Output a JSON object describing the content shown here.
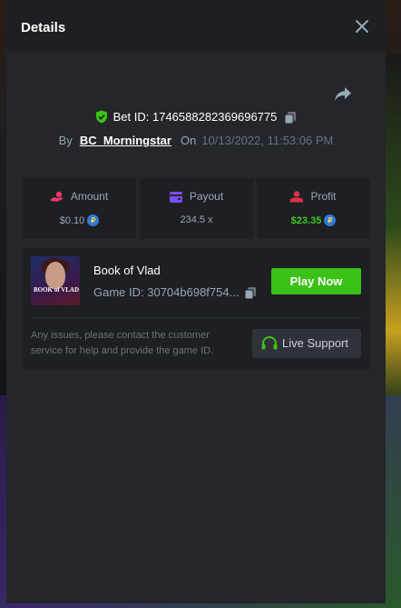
{
  "modal": {
    "title": "Details"
  },
  "bet": {
    "id_text": "Bet ID: 1746588282369696775",
    "by_label": "By",
    "user": "BC_Morningstar",
    "on_label": "On",
    "date": "10/13/2022, 11:53:06 PM"
  },
  "stats": {
    "amount": {
      "label": "Amount",
      "value": "$0.10"
    },
    "payout": {
      "label": "Payout",
      "value": "234.5 x"
    },
    "profit": {
      "label": "Profit",
      "value": "$23.35"
    }
  },
  "game": {
    "name": "Book of Vlad",
    "id_text": "Game ID: 30704b698f754...",
    "thumb_title": "BOOK of VLAD",
    "play_label": "Play Now",
    "note": "Any issues, please contact the customer service for help and provide the game ID.",
    "support_label": "Live Support"
  },
  "colors": {
    "accent_green": "#3bc117",
    "profit_green": "#40c820",
    "shield_green": "#3bc117",
    "amount_icon": "#e8386a",
    "payout_icon": "#7a4dff",
    "profit_icon": "#e0304a",
    "panel": "#24262b",
    "card": "#1d1f23"
  },
  "icons": {
    "close": "close-icon",
    "share": "share-icon",
    "shield": "shield-check-icon",
    "copy": "copy-icon",
    "amount": "hand-coin-icon",
    "payout": "wallet-icon",
    "profit": "profit-icon",
    "coin": "currency-coin-icon",
    "headset": "headset-icon"
  }
}
